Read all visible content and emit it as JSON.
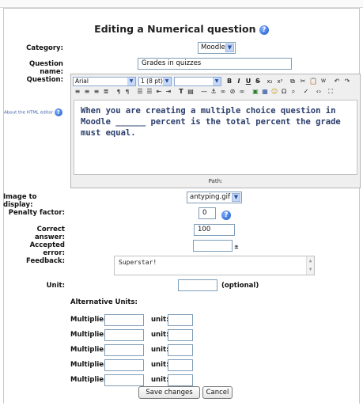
{
  "page": {
    "title": "Editing a Numerical question"
  },
  "form": {
    "category": {
      "label": "Category:",
      "value": "Moodle"
    },
    "question_name": {
      "label": "Question name:",
      "value": "Grades in quizzes"
    },
    "question": {
      "label": "Question:",
      "html_editor_link": "About the HTML editor",
      "content": "When you are creating a multiple choice question in Moodle ______ percent is the total percent the grade must equal.",
      "path_label": "Path:"
    },
    "toolbar": {
      "font_family": "Arial",
      "font_size": "1 (8 pt)",
      "style": ""
    },
    "image": {
      "label": "Image to display:",
      "value": "antyping.gif"
    },
    "penalty": {
      "label": "Penalty factor:",
      "value": "0"
    },
    "correct_answer": {
      "label": "Correct answer:",
      "value": "100"
    },
    "accepted_error": {
      "label": "Accepted error:",
      "value": "",
      "marker": "±"
    },
    "feedback": {
      "label": "Feedback:",
      "value": "Superstar!"
    },
    "unit": {
      "label": "Unit:",
      "value": "",
      "note": "(optional)"
    },
    "alternative_units": {
      "heading": "Alternative Units:",
      "multiplier_label": "Multiplier:",
      "unit_label": "unit:",
      "rows": [
        {
          "multiplier": "",
          "unit": ""
        },
        {
          "multiplier": "",
          "unit": ""
        },
        {
          "multiplier": "",
          "unit": ""
        },
        {
          "multiplier": "",
          "unit": ""
        },
        {
          "multiplier": "",
          "unit": ""
        }
      ]
    }
  },
  "buttons": {
    "save": "Save changes",
    "cancel": "Cancel"
  },
  "colors": {
    "help_icon": "#1b56c6",
    "input_border": "#7f9db9",
    "editor_text": "#2a3d6b"
  }
}
